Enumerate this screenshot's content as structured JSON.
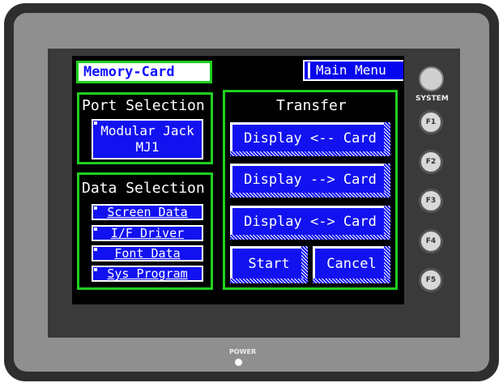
{
  "header": {
    "title": "Memory-Card",
    "main_menu_label": "Main Menu"
  },
  "port_selection": {
    "title": "Port Selection",
    "button_label_line1": "Modular Jack",
    "button_label_line2": "MJ1"
  },
  "data_selection": {
    "title": "Data Selection",
    "items": [
      {
        "label": "Screen Data"
      },
      {
        "label": "I/F Driver"
      },
      {
        "label": "Font Data"
      },
      {
        "label": "Sys Program"
      }
    ]
  },
  "transfer": {
    "title": "Transfer",
    "buttons": [
      {
        "label": "Display <-- Card"
      },
      {
        "label": "Display --> Card"
      },
      {
        "label": "Display <-> Card"
      }
    ],
    "start_label": "Start",
    "cancel_label": "Cancel"
  },
  "hardware": {
    "system_label": "SYSTEM",
    "function_keys": [
      "F1",
      "F2",
      "F3",
      "F4",
      "F5"
    ],
    "power_label": "POWER"
  }
}
